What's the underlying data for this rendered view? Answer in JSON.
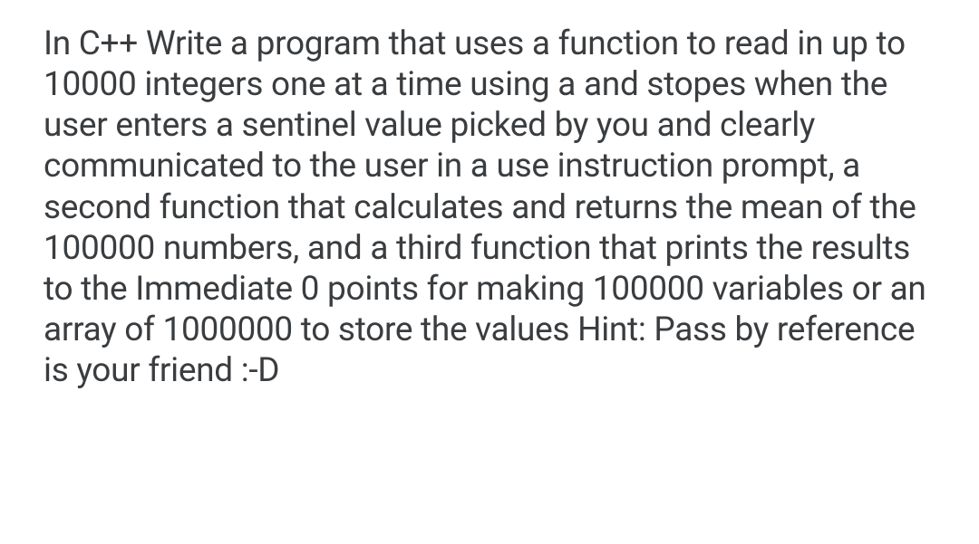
{
  "text": "In C++ Write a program that uses a function to read in up to 10000 integers one at a time using a and stopes when the user enters a sentinel value picked by you and clearly communicated to the user in a use instruction prompt, a second function that calculates and returns the mean of the 100000 numbers, and a third function that prints the results to the Immediate 0 points for making 100000 variables or an array of 1000000 to store the values Hint: Pass by reference is your friend :-D"
}
